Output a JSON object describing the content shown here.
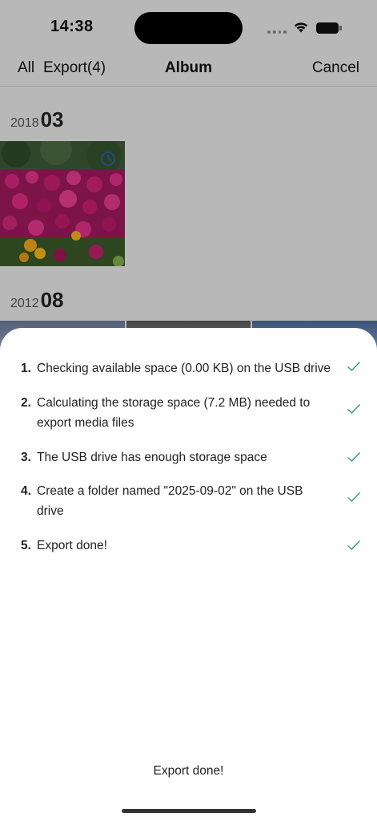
{
  "status_bar": {
    "time": "14:38"
  },
  "nav": {
    "all_label": "All",
    "export_label": "Export(4)",
    "title": "Album",
    "cancel_label": "Cancel"
  },
  "sections": [
    {
      "year": "2018",
      "month": "03"
    },
    {
      "year": "2012",
      "month": "08"
    }
  ],
  "export_sheet": {
    "steps": [
      {
        "number": "1.",
        "text": "Checking available space (0.00 KB) on the USB drive",
        "status": "done"
      },
      {
        "number": "2.",
        "text": "Calculating the storage space (7.2 MB) needed to export media files",
        "status": "done"
      },
      {
        "number": "3.",
        "text": "The USB drive has enough storage space",
        "status": "done"
      },
      {
        "number": "4.",
        "text": "Create a folder named \"2025-09-02\" on the USB drive",
        "status": "done"
      },
      {
        "number": "5.",
        "text": "Export done!",
        "status": "done"
      }
    ],
    "footer_status": "Export done!"
  },
  "icons": {
    "step_status": "checkmark-icon",
    "thumb_badge": "clock-icon",
    "wifi": "wifi-icon",
    "battery": "battery-icon"
  },
  "colors": {
    "check": "#2e9e7a",
    "badge": "#2b5fb5",
    "sheet_bg": "#ffffff"
  }
}
